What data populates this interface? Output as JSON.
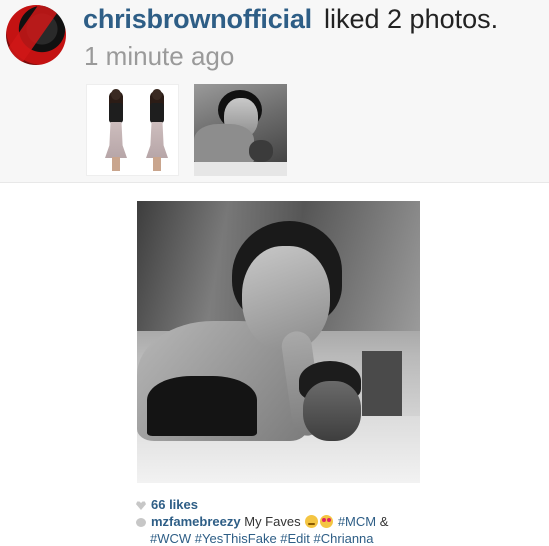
{
  "notification": {
    "username": "chrisbrownofficial",
    "action": "liked 2 photos.",
    "time": "1 minute ago"
  },
  "post": {
    "likes": "66 likes",
    "caption": {
      "author": "mzfamebreezy",
      "text": "My Faves",
      "tags_line1": "#MCM",
      "amp": "&",
      "tags_line2": "#WCW #YesThisFake #Edit #Chrianna"
    }
  },
  "icons": {
    "likes": "heart-icon",
    "comment": "comment-icon",
    "emoji1": "smiling-blush-emoji",
    "emoji2": "heart-eyes-emoji"
  },
  "colors": {
    "username": "#2e5e86",
    "time": "#9a9a9a",
    "notification_bg": "#f7f7f7"
  }
}
